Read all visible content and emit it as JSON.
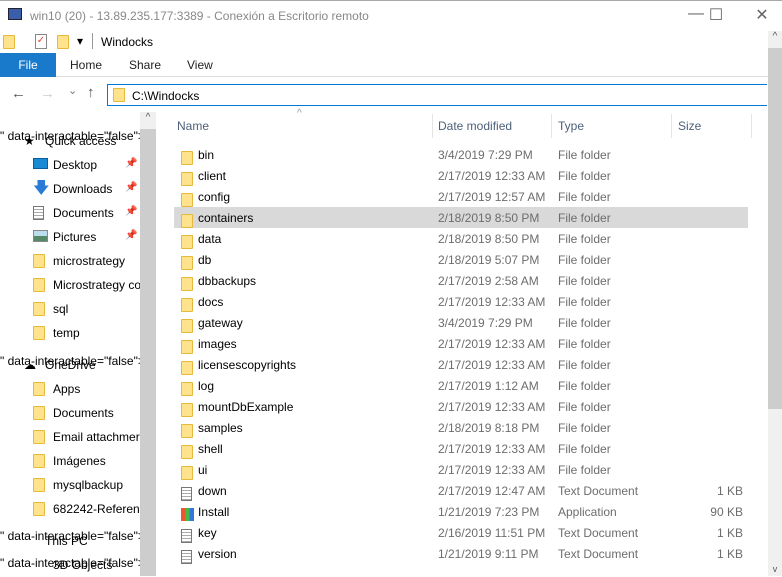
{
  "window": {
    "title": "win10 (20) - 13.89.235.177:3389 - Conexión a Escritorio remoto",
    "minimize": "—",
    "maximize": "☐",
    "close": "✕"
  },
  "qat": {
    "folder_title": "Windocks",
    "dropdown": "▾"
  },
  "ribbon": {
    "tabs": [
      "File",
      "Home",
      "Share",
      "View"
    ]
  },
  "nav_buttons": {
    "back": "←",
    "forward": "→",
    "recent": "⌄",
    "up": "↑"
  },
  "address": {
    "value": "C:\\Windocks"
  },
  "sidebar": {
    "quick_access": "Quick access",
    "quick_items": [
      {
        "label": "Desktop",
        "icon": "desktop-icon",
        "pinned": true
      },
      {
        "label": "Downloads",
        "icon": "download-icon",
        "pinned": true
      },
      {
        "label": "Documents",
        "icon": "documents-icon",
        "pinned": true
      },
      {
        "label": "Pictures",
        "icon": "pictures-icon",
        "pinned": true
      },
      {
        "label": "microstrategy",
        "icon": "folder-icon",
        "pinned": false
      },
      {
        "label": "Microstrategy co",
        "icon": "folder-icon",
        "pinned": false
      },
      {
        "label": "sql",
        "icon": "folder-icon",
        "pinned": false
      },
      {
        "label": "temp",
        "icon": "folder-icon",
        "pinned": false
      }
    ],
    "onedrive": "OneDrive",
    "onedrive_items": [
      "Apps",
      "Documents",
      "Email attachmer",
      "Imágenes",
      "mysqlbackup",
      "682242-Referenc"
    ],
    "this_pc": "This PC",
    "pc_items": [
      "3D Objects"
    ]
  },
  "columns": {
    "name": "Name",
    "date": "Date modified",
    "type": "Type",
    "size": "Size",
    "sort": "^"
  },
  "files": [
    {
      "name": "bin",
      "date": "3/4/2019 7:29 PM",
      "type": "File folder",
      "size": "",
      "icon": "folder"
    },
    {
      "name": "client",
      "date": "2/17/2019 12:33 AM",
      "type": "File folder",
      "size": "",
      "icon": "folder"
    },
    {
      "name": "config",
      "date": "2/17/2019 12:57 AM",
      "type": "File folder",
      "size": "",
      "icon": "folder"
    },
    {
      "name": "containers",
      "date": "2/18/2019 8:50 PM",
      "type": "File folder",
      "size": "",
      "icon": "folder",
      "selected": true
    },
    {
      "name": "data",
      "date": "2/18/2019 8:50 PM",
      "type": "File folder",
      "size": "",
      "icon": "folder"
    },
    {
      "name": "db",
      "date": "2/18/2019 5:07 PM",
      "type": "File folder",
      "size": "",
      "icon": "folder"
    },
    {
      "name": "dbbackups",
      "date": "2/17/2019 2:58 AM",
      "type": "File folder",
      "size": "",
      "icon": "folder"
    },
    {
      "name": "docs",
      "date": "2/17/2019 12:33 AM",
      "type": "File folder",
      "size": "",
      "icon": "folder"
    },
    {
      "name": "gateway",
      "date": "3/4/2019 7:29 PM",
      "type": "File folder",
      "size": "",
      "icon": "folder"
    },
    {
      "name": "images",
      "date": "2/17/2019 12:33 AM",
      "type": "File folder",
      "size": "",
      "icon": "folder"
    },
    {
      "name": "licensescopyrights",
      "date": "2/17/2019 12:33 AM",
      "type": "File folder",
      "size": "",
      "icon": "folder"
    },
    {
      "name": "log",
      "date": "2/17/2019 1:12 AM",
      "type": "File folder",
      "size": "",
      "icon": "folder"
    },
    {
      "name": "mountDbExample",
      "date": "2/17/2019 12:33 AM",
      "type": "File folder",
      "size": "",
      "icon": "folder"
    },
    {
      "name": "samples",
      "date": "2/18/2019 8:18 PM",
      "type": "File folder",
      "size": "",
      "icon": "folder"
    },
    {
      "name": "shell",
      "date": "2/17/2019 12:33 AM",
      "type": "File folder",
      "size": "",
      "icon": "folder"
    },
    {
      "name": "ui",
      "date": "2/17/2019 12:33 AM",
      "type": "File folder",
      "size": "",
      "icon": "folder"
    },
    {
      "name": "down",
      "date": "2/17/2019 12:47 AM",
      "type": "Text Document",
      "size": "1 KB",
      "icon": "doc"
    },
    {
      "name": "Install",
      "date": "1/21/2019 7:23 PM",
      "type": "Application",
      "size": "90 KB",
      "icon": "app"
    },
    {
      "name": "key",
      "date": "2/16/2019 11:51 PM",
      "type": "Text Document",
      "size": "1 KB",
      "icon": "doc"
    },
    {
      "name": "version",
      "date": "1/21/2019 9:11 PM",
      "type": "Text Document",
      "size": "1 KB",
      "icon": "doc"
    }
  ],
  "colors": {
    "accent": "#0078d7",
    "file_tab": "#1979ca",
    "selection": "#d9d9d9"
  }
}
